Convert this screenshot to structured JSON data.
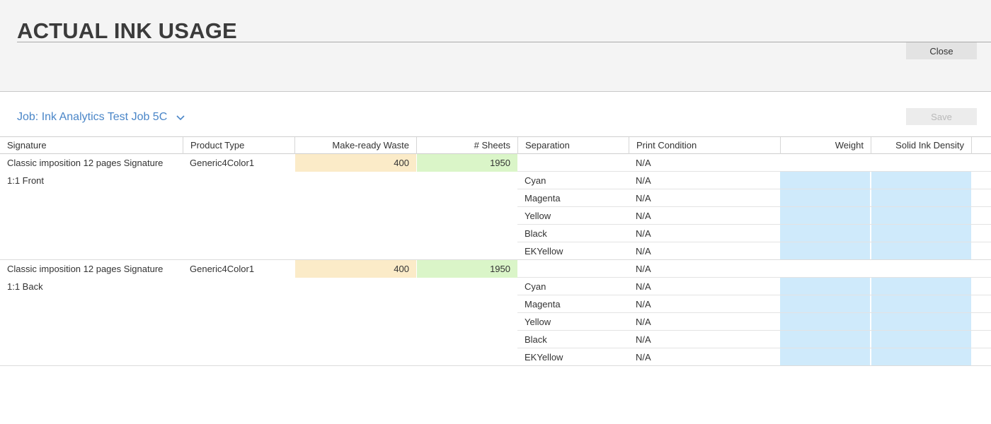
{
  "header": {
    "title": "ACTUAL INK USAGE",
    "close_label": "Close"
  },
  "job": {
    "label": "Job: Ink Analytics Test Job 5C",
    "save_label": "Save"
  },
  "columns": [
    "Signature",
    "Product Type",
    "Make-ready Waste",
    "# Sheets",
    "Separation",
    "Print Condition",
    "Weight",
    "Solid Ink Density"
  ],
  "groups": [
    {
      "signature": "Classic imposition 12 pages Signature",
      "side": "1:1 Front",
      "product_type": "Generic4Color1",
      "makeready_waste": "400",
      "sheets": "1950",
      "print_condition": "N/A",
      "separations": [
        {
          "name": "Cyan",
          "print_condition": "N/A"
        },
        {
          "name": "Magenta",
          "print_condition": "N/A"
        },
        {
          "name": "Yellow",
          "print_condition": "N/A"
        },
        {
          "name": "Black",
          "print_condition": "N/A"
        },
        {
          "name": "EKYellow",
          "print_condition": "N/A"
        }
      ]
    },
    {
      "signature": "Classic imposition 12 pages Signature",
      "side": "1:1 Back",
      "product_type": "Generic4Color1",
      "makeready_waste": "400",
      "sheets": "1950",
      "print_condition": "N/A",
      "separations": [
        {
          "name": "Cyan",
          "print_condition": "N/A"
        },
        {
          "name": "Magenta",
          "print_condition": "N/A"
        },
        {
          "name": "Yellow",
          "print_condition": "N/A"
        },
        {
          "name": "Black",
          "print_condition": "N/A"
        },
        {
          "name": "EKYellow",
          "print_condition": "N/A"
        }
      ]
    }
  ],
  "colors": {
    "accent": "#4a86c8",
    "waste_bg": "#fbebc8",
    "sheets_bg": "#daf5c8",
    "input_bg": "#cfeafb"
  },
  "icons": {
    "job_dropdown": "chevron-down-icon"
  }
}
